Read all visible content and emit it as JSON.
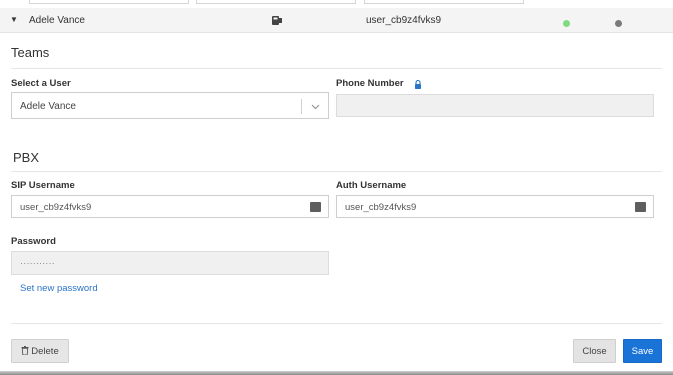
{
  "row": {
    "caret": "▼",
    "name": "Adele Vance",
    "username": "user_cb9z4fvks9",
    "status_left_color": "#7fdb7f",
    "status_right_color": "#7a7a7a",
    "device_icon": "phone-device-icon"
  },
  "teams": {
    "title": "Teams",
    "select_user_label": "Select a User",
    "select_user_value": "Adele Vance",
    "phone_number_label": "Phone Number",
    "phone_number_value": ""
  },
  "pbx": {
    "title": "PBX",
    "sip_username_label": "SIP Username",
    "sip_username_value": "user_cb9z4fvks9",
    "auth_username_label": "Auth Username",
    "auth_username_value": "user_cb9z4fvks9",
    "password_label": "Password",
    "password_value": "···········",
    "set_new_password": "Set new password"
  },
  "footer": {
    "delete_label": "Delete",
    "close_label": "Close",
    "save_label": "Save"
  },
  "colors": {
    "accent": "#1a73d6",
    "link": "#2b74c7"
  }
}
